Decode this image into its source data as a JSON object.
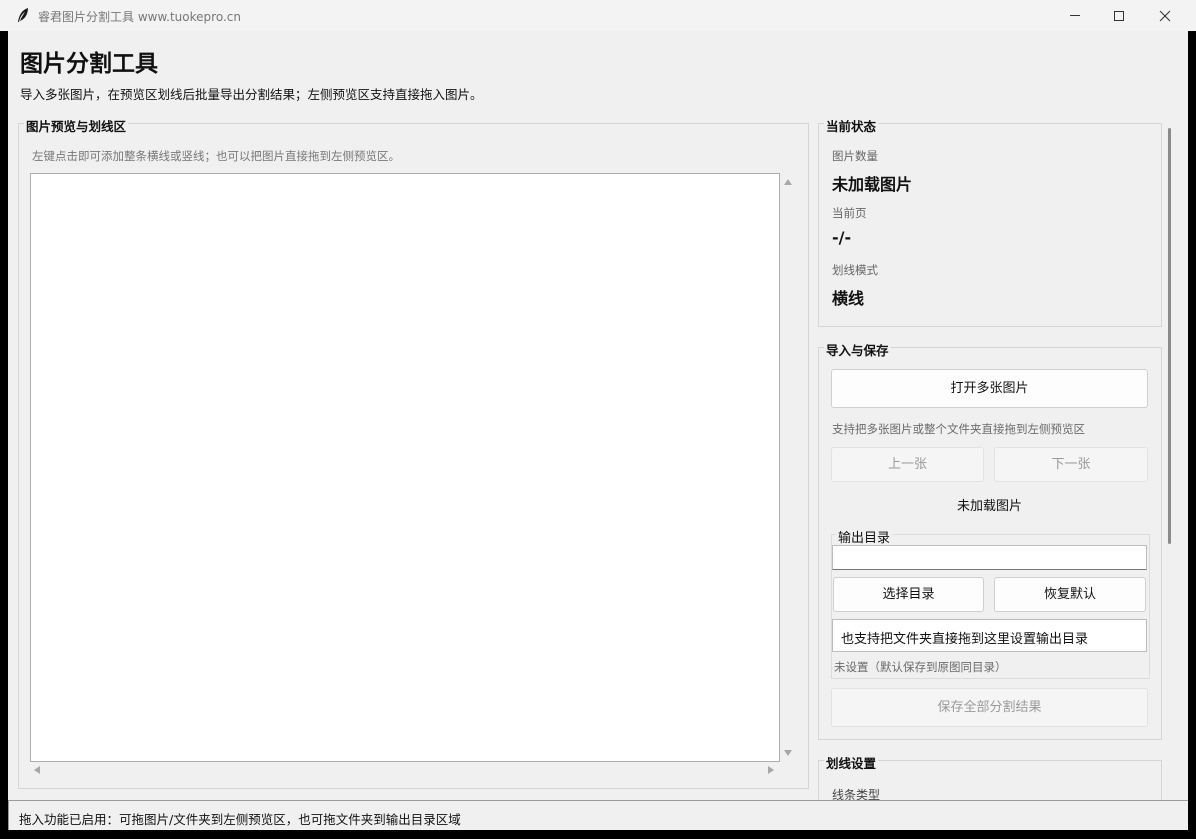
{
  "window": {
    "title": "睿君图片分割工具  www.tuokepro.cn",
    "icons": [
      "feather-icon",
      "minimize-icon",
      "maximize-icon",
      "close-icon"
    ]
  },
  "header": {
    "title": "图片分割工具",
    "subtitle": "导入多张图片，在预览区划线后批量导出分割结果；左侧预览区支持直接拖入图片。"
  },
  "preview": {
    "group_title": "图片预览与划线区",
    "hint": "左键点击即可添加整条横线或竖线；也可以把图片直接拖到左侧预览区。"
  },
  "status": {
    "group_title": "当前状态",
    "image_count_label": "图片数量",
    "image_count_value": "未加载图片",
    "current_page_label": "当前页",
    "current_page_value": "-/-",
    "line_mode_label": "划线模式",
    "line_mode_value": "横线"
  },
  "import_save": {
    "group_title": "导入与保存",
    "open_button": "打开多张图片",
    "drag_hint": "支持把多张图片或整个文件夹直接拖到左侧预览区",
    "prev_button": "上一张",
    "next_button": "下一张",
    "load_status": "未加载图片",
    "output_dir_title": "输出目录",
    "output_dir_value": "",
    "choose_dir_button": "选择目录",
    "reset_button": "恢复默认",
    "drop_hint": "也支持把文件夹直接拖到这里设置输出目录",
    "dir_status": "未设置（默认保存到原图同目录）",
    "save_all_button": "保存全部分割结果"
  },
  "line_settings": {
    "group_title": "划线设置",
    "partial_label": "线条类型"
  },
  "statusbar": {
    "text": "拖入功能已启用：可拖图片/文件夹到左侧预览区，也可拖文件夹到输出目录区域"
  }
}
